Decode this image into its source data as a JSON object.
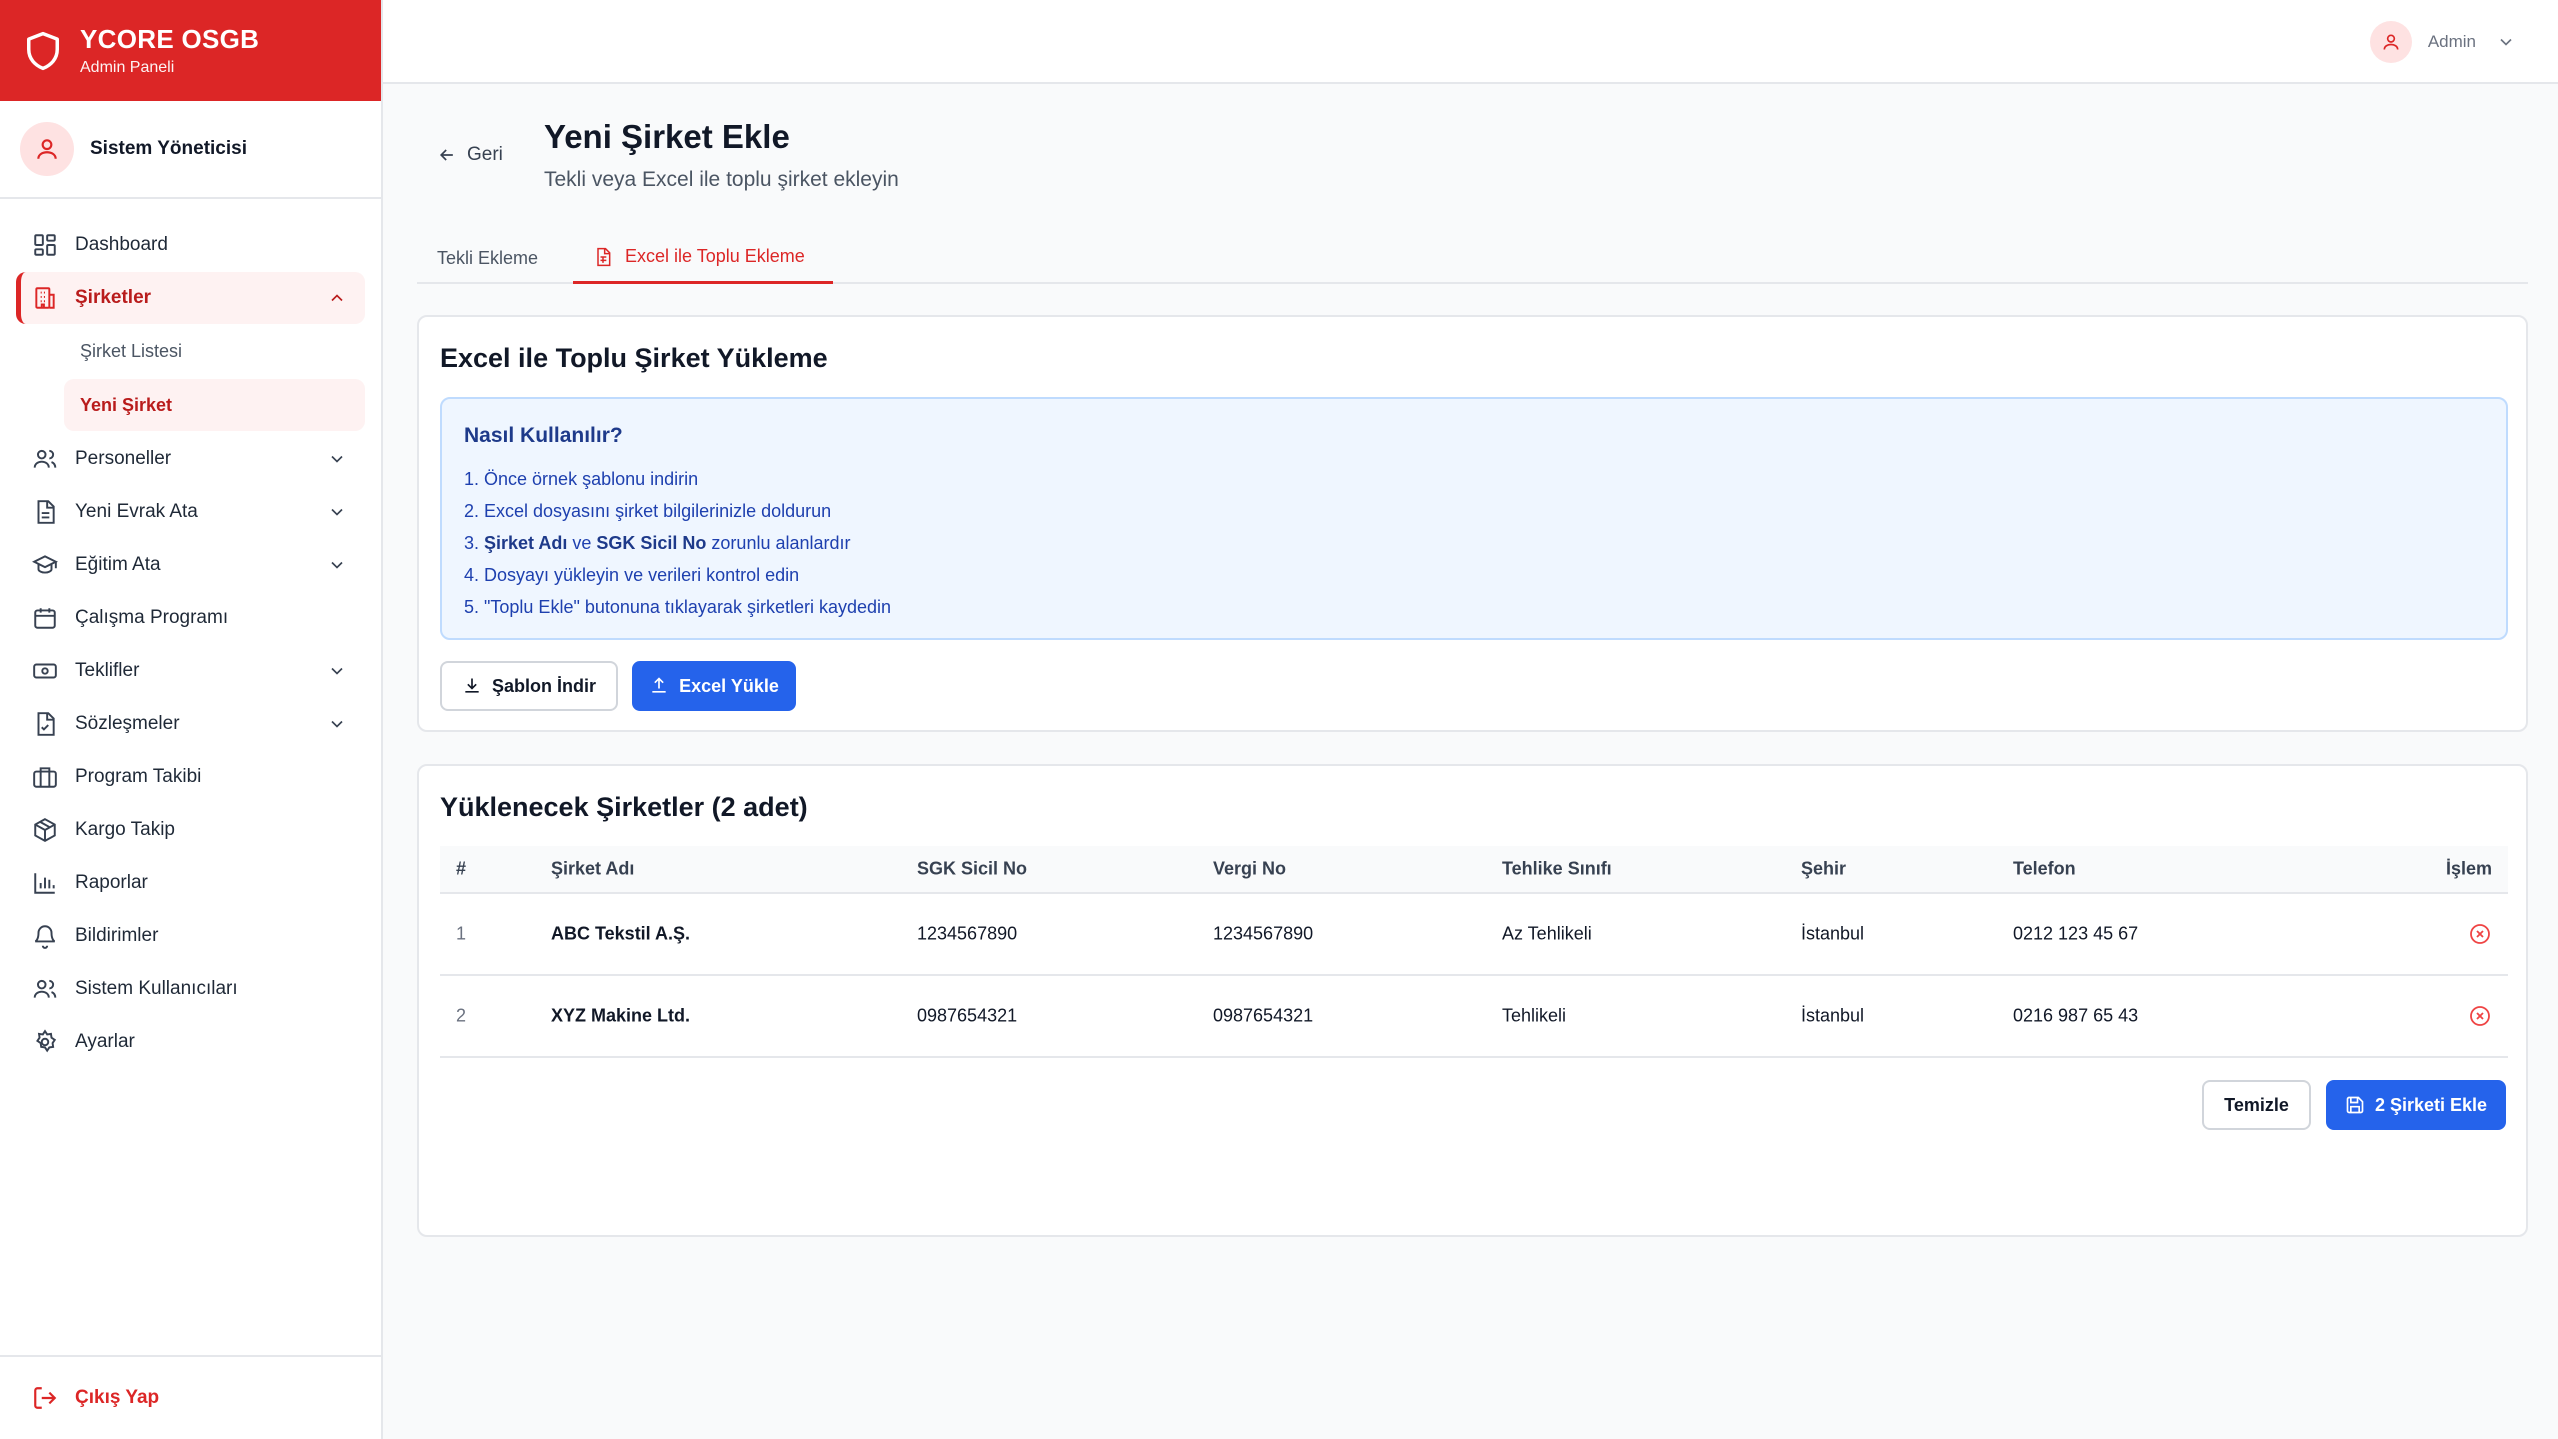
{
  "brand": {
    "title": "YCORE OSGB",
    "subtitle": "Admin Paneli"
  },
  "user": {
    "name": "Sistem Yöneticisi"
  },
  "sidebar": {
    "items": [
      {
        "label": "Dashboard",
        "icon": "dashboard-icon"
      },
      {
        "label": "Şirketler",
        "icon": "building-icon",
        "active": true,
        "expanded": true,
        "children": [
          {
            "label": "Şirket Listesi"
          },
          {
            "label": "Yeni Şirket",
            "active": true
          }
        ]
      },
      {
        "label": "Personeller",
        "icon": "users-icon"
      },
      {
        "label": "Yeni Evrak Ata",
        "icon": "document-icon"
      },
      {
        "label": "Eğitim Ata",
        "icon": "graduation-cap-icon"
      },
      {
        "label": "Çalışma Programı",
        "icon": "calendar-icon"
      },
      {
        "label": "Teklifler",
        "icon": "money-icon"
      },
      {
        "label": "Sözleşmeler",
        "icon": "contract-icon"
      },
      {
        "label": "Program Takibi",
        "icon": "briefcase-icon"
      },
      {
        "label": "Kargo Takip",
        "icon": "package-icon"
      },
      {
        "label": "Raporlar",
        "icon": "bar-chart-icon"
      },
      {
        "label": "Bildirimler",
        "icon": "bell-icon"
      },
      {
        "label": "Sistem Kullanıcıları",
        "icon": "users-icon"
      },
      {
        "label": "Ayarlar",
        "icon": "gear-icon"
      }
    ],
    "logout": "Çıkış Yap"
  },
  "topbar": {
    "user_label": "Admin"
  },
  "page": {
    "back": "Geri",
    "title": "Yeni Şirket Ekle",
    "subtitle": "Tekli veya Excel ile toplu şirket ekleyin",
    "tabs": [
      {
        "label": "Tekli Ekleme"
      },
      {
        "label": "Excel ile Toplu Ekleme",
        "active": true
      }
    ]
  },
  "upload": {
    "title": "Excel ile Toplu Şirket Yükleme",
    "howto_title": "Nasıl Kullanılır?",
    "steps": {
      "s1": "1. Önce örnek şablonu indirin",
      "s2": "2. Excel dosyasını şirket bilgilerinizle doldurun",
      "s3_prefix": "3. ",
      "s3_b1": "Şirket Adı",
      "s3_mid": " ve ",
      "s3_b2": "SGK Sicil No",
      "s3_suffix": " zorunlu alanlardır",
      "s4": "4. Dosyayı yükleyin ve verileri kontrol edin",
      "s5": "5. \"Toplu Ekle\" butonuna tıklayarak şirketleri kaydedin"
    },
    "download_btn": "Şablon İndir",
    "upload_btn": "Excel Yükle"
  },
  "preview": {
    "title": "Yüklenecek Şirketler (2 adet)",
    "columns": [
      "#",
      "Şirket Adı",
      "SGK Sicil No",
      "Vergi No",
      "Tehlike Sınıfı",
      "Şehir",
      "Telefon",
      "İşlem"
    ],
    "rows": [
      [
        "1",
        "ABC Tekstil A.Ş.",
        "1234567890",
        "1234567890",
        "Az Tehlikeli",
        "İstanbul",
        "0212 123 45 67"
      ],
      [
        "2",
        "XYZ Makine Ltd.",
        "0987654321",
        "0987654321",
        "Tehlikeli",
        "İstanbul",
        "0216 987 65 43"
      ]
    ],
    "clear_btn": "Temizle",
    "add_btn": "2 Şirketi Ekle"
  },
  "colors": {
    "brand": "#dc2626",
    "primary": "#2563eb",
    "info_bg": "#eff6ff"
  }
}
